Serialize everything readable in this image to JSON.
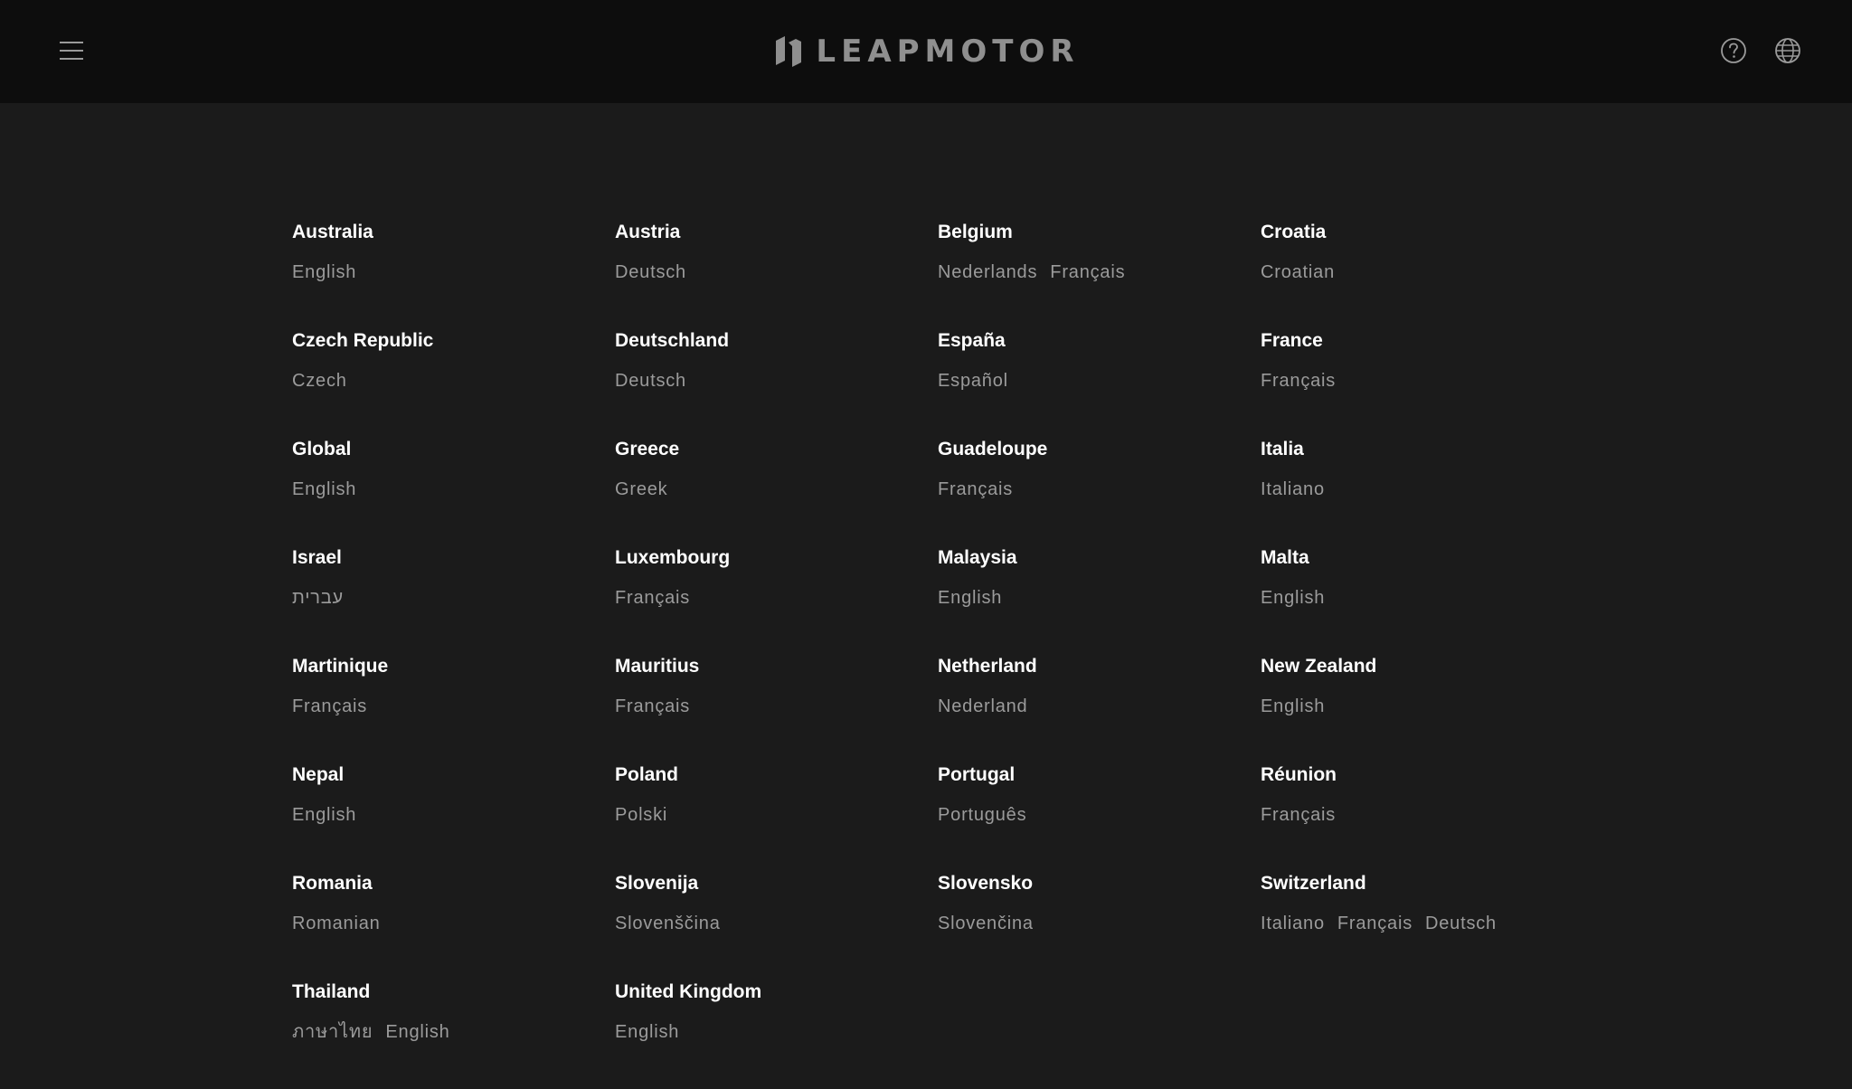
{
  "header": {
    "logo_text": "LEAPMOTOR",
    "icons": [
      "menu-icon",
      "help-icon",
      "globe-icon"
    ]
  },
  "colors": {
    "header_bg": "#0d0d0d",
    "page_bg": "#1b1b1b",
    "country_text": "#ffffff",
    "language_text": "#9b9b9b"
  },
  "regions": [
    {
      "country": "Australia",
      "languages": [
        "English"
      ]
    },
    {
      "country": "Austria",
      "languages": [
        "Deutsch"
      ]
    },
    {
      "country": "Belgium",
      "languages": [
        "Nederlands",
        "Français"
      ]
    },
    {
      "country": "Croatia",
      "languages": [
        "Croatian"
      ]
    },
    {
      "country": "Czech Republic",
      "languages": [
        "Czech"
      ]
    },
    {
      "country": "Deutschland",
      "languages": [
        "Deutsch"
      ]
    },
    {
      "country": "España",
      "languages": [
        "Español"
      ]
    },
    {
      "country": "France",
      "languages": [
        "Français"
      ]
    },
    {
      "country": "Global",
      "languages": [
        "English"
      ]
    },
    {
      "country": "Greece",
      "languages": [
        "Greek"
      ]
    },
    {
      "country": "Guadeloupe",
      "languages": [
        "Français"
      ]
    },
    {
      "country": "Italia",
      "languages": [
        "Italiano"
      ]
    },
    {
      "country": "Israel",
      "languages": [
        "עברית"
      ]
    },
    {
      "country": "Luxembourg",
      "languages": [
        "Français"
      ]
    },
    {
      "country": "Malaysia",
      "languages": [
        "English"
      ]
    },
    {
      "country": "Malta",
      "languages": [
        "English"
      ]
    },
    {
      "country": "Martinique",
      "languages": [
        "Français"
      ]
    },
    {
      "country": "Mauritius",
      "languages": [
        "Français"
      ]
    },
    {
      "country": "Netherland",
      "languages": [
        "Nederland"
      ]
    },
    {
      "country": "New Zealand",
      "languages": [
        "English"
      ]
    },
    {
      "country": "Nepal",
      "languages": [
        "English"
      ]
    },
    {
      "country": "Poland",
      "languages": [
        "Polski"
      ]
    },
    {
      "country": "Portugal",
      "languages": [
        "Português"
      ]
    },
    {
      "country": "Réunion",
      "languages": [
        "Français"
      ]
    },
    {
      "country": "Romania",
      "languages": [
        "Romanian"
      ]
    },
    {
      "country": "Slovenija",
      "languages": [
        "Slovenščina"
      ]
    },
    {
      "country": "Slovensko",
      "languages": [
        "Slovenčina"
      ]
    },
    {
      "country": "Switzerland",
      "languages": [
        "Italiano",
        "Français",
        "Deutsch"
      ]
    },
    {
      "country": "Thailand",
      "languages": [
        "ภาษาไทย",
        "English"
      ]
    },
    {
      "country": "United Kingdom",
      "languages": [
        "English"
      ]
    }
  ]
}
